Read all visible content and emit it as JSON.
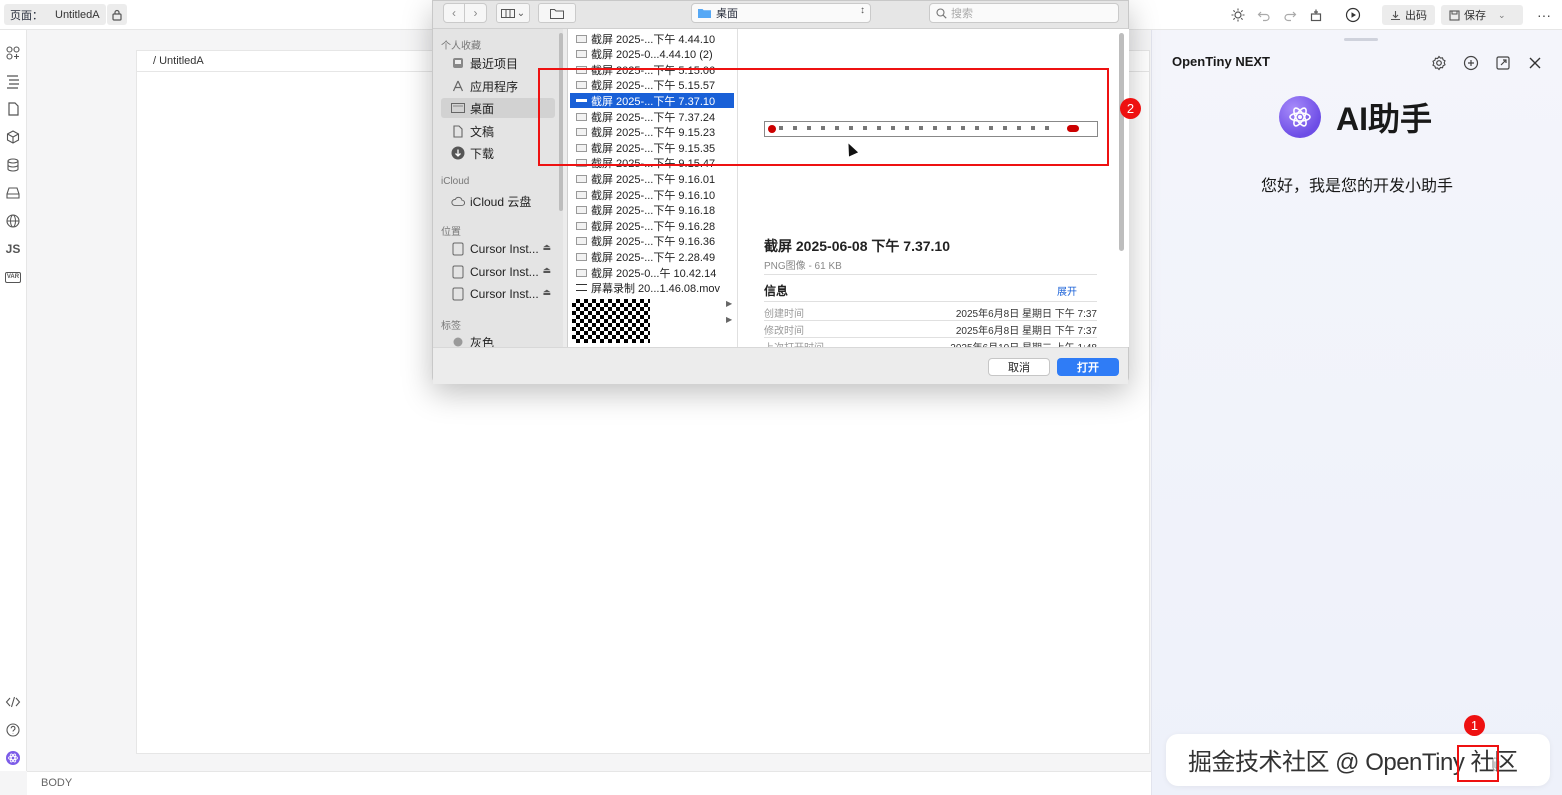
{
  "topbar": {
    "page_label": "页面：",
    "page_value": "UntitledA",
    "export_label": "出码",
    "save_label": "保存"
  },
  "leftnav": {
    "js_label": "JS",
    "var_label": "VAR"
  },
  "canvas": {
    "breadcrumb": "/ UntitledA",
    "status_path": "BODY"
  },
  "dialog": {
    "location": "桌面",
    "search_placeholder": "搜索",
    "sidebar": {
      "favorites_title": "个人收藏",
      "favorites": [
        {
          "label": "最近项目",
          "icon": "clock-icon"
        },
        {
          "label": "应用程序",
          "icon": "apps-icon"
        },
        {
          "label": "桌面",
          "icon": "desktop-icon"
        },
        {
          "label": "文稿",
          "icon": "document-icon"
        },
        {
          "label": "下载",
          "icon": "download-icon"
        }
      ],
      "icloud_title": "iCloud",
      "icloud_drive": "iCloud 云盘",
      "locations_title": "位置",
      "locations": [
        "Cursor Inst...",
        "Cursor Inst...",
        "Cursor Inst..."
      ],
      "tags_title": "标签",
      "tag_gray": "灰色"
    },
    "files": [
      "截屏 2025-...下午 4.44.10",
      "截屏 2025-0...4.44.10 (2)",
      "截屏 2025-...下午 5.15.06",
      "截屏 2025-...下午 5.15.57",
      "截屏 2025-...下午 7.37.10",
      "截屏 2025-...下午 7.37.24",
      "截屏 2025-...下午 9.15.23",
      "截屏 2025-...下午 9.15.35",
      "截屏 2025-...下午 9.15.47",
      "截屏 2025-...下午 9.16.01",
      "截屏 2025-...下午 9.16.10",
      "截屏 2025-...下午 9.16.18",
      "截屏 2025-...下午 9.16.28",
      "截屏 2025-...下午 9.16.36",
      "截屏 2025-...下午 2.28.49",
      "截屏 2025-0...午 10.42.14",
      "屏幕录制 20...1.46.08.mov"
    ],
    "selected_index": 4,
    "preview": {
      "name": "截屏 2025-06-08 下午 7.37.10",
      "type": "PNG图像 - 61 KB",
      "info_title": "信息",
      "expand": "展开",
      "rows": [
        {
          "key": "创建时间",
          "value": "2025年6月8日 星期日 下午 7:37"
        },
        {
          "key": "修改时间",
          "value": "2025年6月8日 星期日 下午 7:37"
        },
        {
          "key": "上次打开时间",
          "value": "2025年6月10日 星期二 上午 1:48"
        }
      ]
    },
    "cancel_label": "取消",
    "open_label": "打开"
  },
  "ai_panel": {
    "title": "OpenTiny NEXT",
    "heading": "AI助手",
    "greeting": "您好，我是您的开发小助手",
    "watermark": "掘金技术社区 @ OpenTiny 社区"
  },
  "annotations": {
    "badge_1": "1",
    "badge_2": "2",
    "color": "#e11111"
  }
}
